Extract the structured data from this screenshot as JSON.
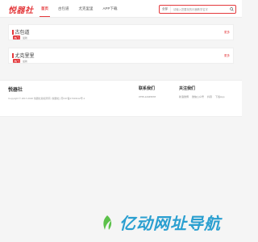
{
  "header": {
    "logo": "悦器社",
    "nav": [
      "首页",
      "古包道",
      "尤克里里",
      "APP下载"
    ],
    "search": {
      "select_label": "全部",
      "placeholder": "请输入您要找的乐器教学名字"
    }
  },
  "sections": [
    {
      "title": "古包道",
      "tag": "热门",
      "sub": "最新",
      "more": "更多"
    },
    {
      "title": "尤克里里",
      "tag": "热门",
      "sub": "最新",
      "more": "更多"
    }
  ],
  "footer": {
    "logo": "悦器社",
    "copyright": "Copyright © 2017-2020 悦器社版权所有 (悦器社)  苏ICP备17019112号-1",
    "contact_title": "联系我们",
    "contact_text": "0755-12345678",
    "follow_title": "关注我们",
    "follow_links": [
      "新浪微博",
      "微信公众号",
      "抖音",
      "下载App"
    ]
  },
  "watermark": {
    "text": "亿动网址导航"
  },
  "colors": {
    "accent": "#e4393c",
    "watermark": "#2a9fd0"
  }
}
